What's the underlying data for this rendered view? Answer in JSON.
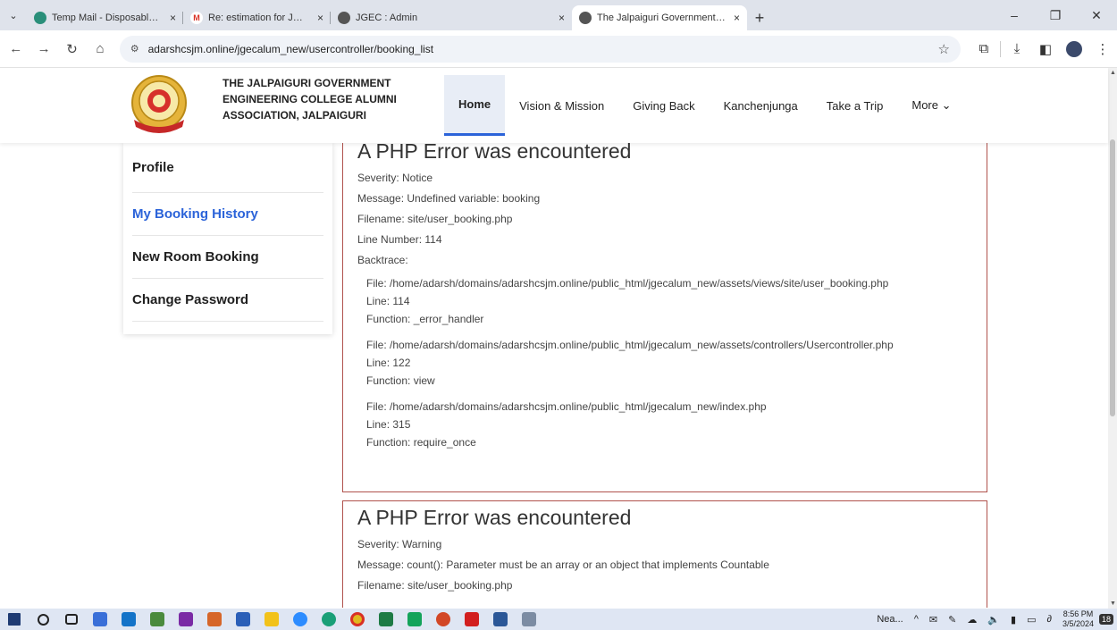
{
  "browser": {
    "tabs": [
      {
        "title": "Temp Mail - Disposable Tempo",
        "icon": "globe-icon",
        "close": "×",
        "color": "#2a8f7a"
      },
      {
        "title": "Re: estimation for JGEC alumni",
        "icon": "gmail-icon",
        "close": "×",
        "color": "#d93025"
      },
      {
        "title": "JGEC : Admin",
        "icon": "globe-icon",
        "close": "×",
        "color": "#555555"
      },
      {
        "title": "The Jalpaiguri Government Eng",
        "icon": "globe-icon",
        "close": "×",
        "color": "#555555"
      }
    ],
    "new_tab": "+",
    "url": "adarshcsjm.online/jgecalum_new/usercontroller/booking_list"
  },
  "site": {
    "brand": "THE JALPAIGURI GOVERNMENT ENGINEERING COLLEGE ALUMNI ASSOCIATION, JALPAIGURI",
    "logo_text": "ALUMNI ASSOCIATION",
    "nav": [
      {
        "label": "Home"
      },
      {
        "label": "Vision & Mission"
      },
      {
        "label": "Giving Back"
      },
      {
        "label": "Kanchenjunga"
      },
      {
        "label": "Take a Trip"
      },
      {
        "label": "More ⌄"
      }
    ],
    "accent": "#2b63d9"
  },
  "sidebar": {
    "items": [
      {
        "label": "Profile"
      },
      {
        "label": "My Booking History"
      },
      {
        "label": "New Room Booking"
      },
      {
        "label": "Change Password"
      }
    ]
  },
  "errors": [
    {
      "heading": "A PHP Error was encountered",
      "severity": "Severity: Notice",
      "message": "Message: Undefined variable: booking",
      "filename": "Filename: site/user_booking.php",
      "line": "Line Number: 114",
      "backtrace_label": "Backtrace:",
      "backtrace": [
        {
          "file": "File: /home/adarsh/domains/adarshcsjm.online/public_html/jgecalum_new/assets/views/site/user_booking.php",
          "line": "Line: 114",
          "function": "Function: _error_handler"
        },
        {
          "file": "File: /home/adarsh/domains/adarshcsjm.online/public_html/jgecalum_new/assets/controllers/Usercontroller.php",
          "line": "Line: 122",
          "function": "Function: view"
        },
        {
          "file": "File: /home/adarsh/domains/adarshcsjm.online/public_html/jgecalum_new/index.php",
          "line": "Line: 315",
          "function": "Function: require_once"
        }
      ]
    },
    {
      "heading": "A PHP Error was encountered",
      "severity": "Severity: Warning",
      "message": "Message: count(): Parameter must be an array or an object that implements Countable",
      "filename": "Filename: site/user_booking.php"
    }
  ],
  "taskbar": {
    "weather": "Nea...",
    "time": "8:56 PM",
    "date": "3/5/2024",
    "notifications": "18"
  }
}
